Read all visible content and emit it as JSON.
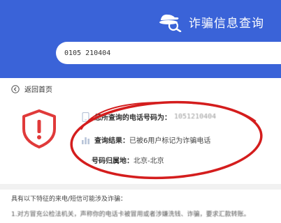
{
  "header": {
    "title": "诈骗信息查询",
    "icon": "detective-magnifier-icon",
    "background": "#3a63d8"
  },
  "search": {
    "value": "0105 210404"
  },
  "nav": {
    "back_label": "返回首页"
  },
  "result": {
    "warning_icon": "shield-warning-icon",
    "warning_color": "#e03a3a",
    "highlight_color": "#d41d1d",
    "phone_label": "您所查询的电话号码为：",
    "phone_value": "1051210404",
    "query_label": "查询结果：",
    "query_value": "已被6用户标记为诈骗电话",
    "location_label": "号码归属地：",
    "location_value": "北京-北京"
  },
  "notes": {
    "title": "具有以下特征的来电/短信可能涉及诈骗：",
    "item1": "1.对方冒充公检法机关，声称你的电话卡被冒用或者涉嫌洗钱、诈骗，要求汇款转账。"
  }
}
